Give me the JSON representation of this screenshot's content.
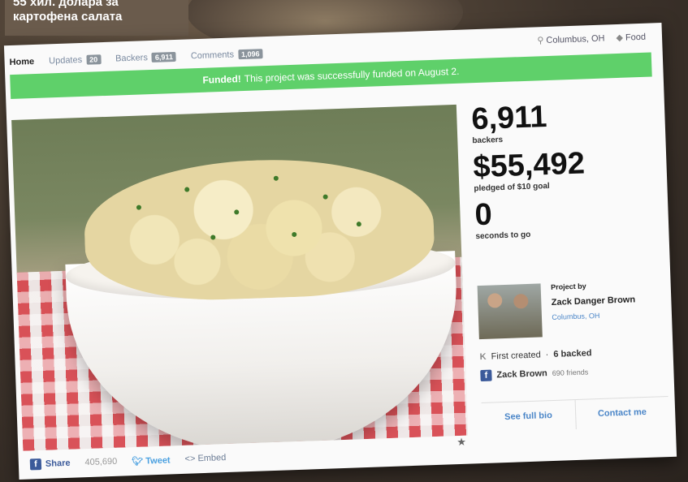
{
  "caption": {
    "line1": "55 хил. долара за",
    "line2": "картофена салата"
  },
  "nav": {
    "home": "Home",
    "updates_label": "Updates",
    "updates_count": "20",
    "backers_label": "Backers",
    "backers_count": "6,911",
    "comments_label": "Comments",
    "comments_count": "1,096"
  },
  "location": {
    "city": "Columbus, OH",
    "category": "Food"
  },
  "banner": {
    "bold": "Funded!",
    "text": "This project was successfully funded on August 2."
  },
  "stats": {
    "backers_value": "6,911",
    "backers_label": "backers",
    "pledged_value": "$55,492",
    "pledged_label": "pledged of $10 goal",
    "time_value": "0",
    "time_label": "seconds to go"
  },
  "creator": {
    "project_by": "Project by",
    "name": "Zack Danger Brown",
    "city": "Columbus, OH",
    "first_created": "First created",
    "backed": "6 backed",
    "fb_name": "Zack Brown",
    "fb_friends": "690 friends",
    "full_bio": "See full bio",
    "contact": "Contact me"
  },
  "share": {
    "fb_label": "Share",
    "fb_count": "405,690",
    "tweet": "Tweet",
    "embed": "<> Embed"
  },
  "icons": {
    "pin": "map-pin-icon",
    "tag": "tag-icon",
    "star": "star-icon"
  },
  "colors": {
    "funded_green": "#5fd06a",
    "link_blue": "#4b86c8",
    "facebook_blue": "#3b5a9a",
    "twitter_blue": "#4aa0e0"
  }
}
